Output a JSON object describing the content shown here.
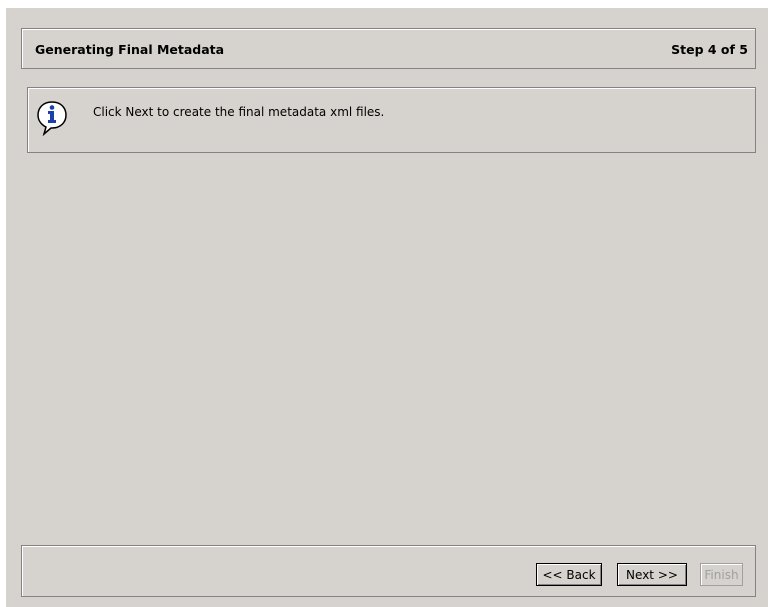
{
  "header": {
    "title": "Generating Final Metadata",
    "step": "Step 4 of 5"
  },
  "info": {
    "icon": "info-icon",
    "message": "Click Next to create the final metadata xml files."
  },
  "buttons": {
    "back": "<< Back",
    "next": "Next >>",
    "finish": "Finish",
    "finish_enabled": false
  },
  "colors": {
    "panel_bg": "#d6d3ce",
    "border": "#848284",
    "icon_blue": "#1c3fa8",
    "disabled_text": "#a0a0a0"
  }
}
